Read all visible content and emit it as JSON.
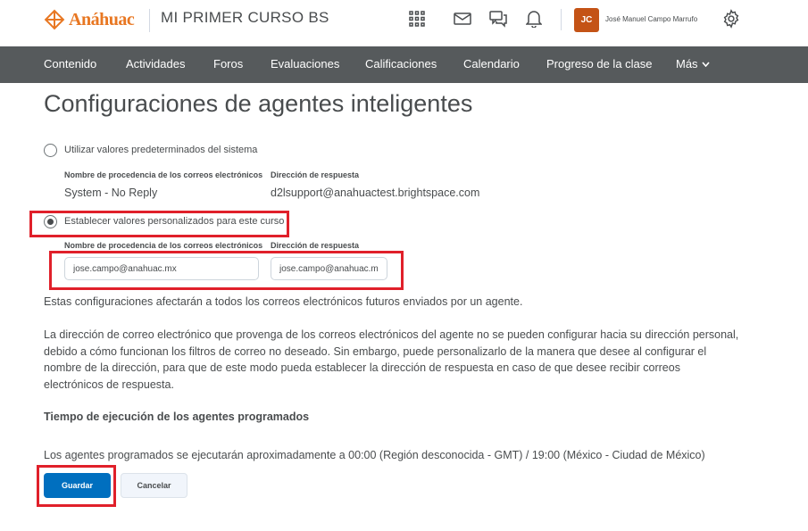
{
  "header": {
    "logo_text": "Anáhuac",
    "course_title": "MI PRIMER CURSO BS",
    "icons": [
      "grid-icon",
      "mail-icon",
      "chat-icon",
      "bell-icon",
      "gear-icon"
    ],
    "user": {
      "initials": "JC",
      "name": "José Manuel Campo Marrufo",
      "avatar_color": "#c45316"
    }
  },
  "nav": {
    "items": [
      "Contenido",
      "Actividades",
      "Foros",
      "Evaluaciones",
      "Calificaciones",
      "Calendario",
      "Progreso de la clase"
    ],
    "more_label": "Más"
  },
  "page": {
    "title": "Configuraciones de agentes inteligentes",
    "option_default": {
      "label": "Utilizar valores predeterminados del sistema",
      "selected": false,
      "from_name_label": "Nombre de procedencia de los correos electrónicos",
      "reply_label": "Dirección de respuesta",
      "from_name_value": "System - No Reply",
      "reply_value": "d2lsupport@anahuactest.brightspace.com"
    },
    "option_custom": {
      "label": "Establecer valores personalizados para este curso",
      "selected": true,
      "from_name_label": "Nombre de procedencia de los correos electrónicos",
      "reply_label": "Dirección de respuesta",
      "from_name_input": "jose.campo@anahuac.mx",
      "reply_input": "jose.campo@anahuac.mx"
    },
    "note1": "Estas configuraciones afectarán a todos los correos electrónicos futuros enviados por un agente.",
    "note2": "La dirección de correo electrónico que provenga de los correos electrónicos del agente no se pueden configurar hacia su dirección personal, debido a cómo funcionan los filtros de correo no deseado. Sin embargo, puede personalizarlo de la manera que desee al configurar el nombre de la dirección, para que de este modo pueda establecer la dirección de respuesta en caso de que desee recibir correos electrónicos de respuesta.",
    "schedule_heading": "Tiempo de ejecución de los agentes programados",
    "schedule_text": "Los agentes programados se ejecutarán aproximadamente a 00:00 (Región desconocida - GMT) / 19:00 (México - Ciudad de México)",
    "save_label": "Guardar",
    "cancel_label": "Cancelar"
  },
  "colors": {
    "nav_bg": "#565a5c",
    "primary": "#006fbf",
    "highlight": "#e0202a",
    "brand": "#e87722"
  }
}
